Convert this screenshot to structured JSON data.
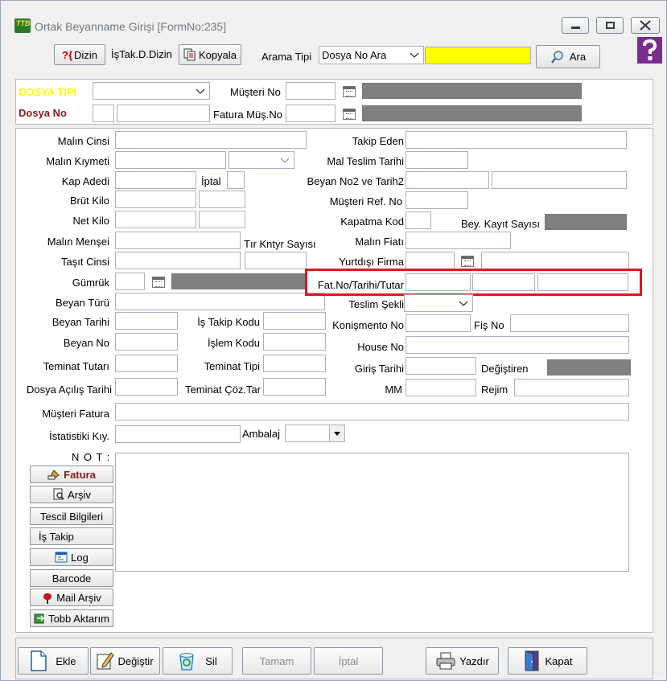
{
  "window": {
    "title": "Ortak Beyanname Girişi [FormNo:235]",
    "icon_text": "TTB",
    "min_icon": "minimize-icon",
    "max_icon": "maximize-icon",
    "close_icon": "close-icon"
  },
  "toolbar": {
    "dizin_label": "Dizin",
    "istak_label": "İşTak.D.Dizin",
    "kopyala_label": "Kopyala",
    "arama_tipi_label": "Arama Tipi",
    "arama_tipi_value": "Dosya No Ara",
    "ara_label": "Ara"
  },
  "top": {
    "dosya_tipi_label": "DOSYA TIPI",
    "musteri_no_label": "Müşteri No",
    "dosya_no_label": "Dosya No",
    "fatura_mus_no_label": "Fatura Müş.No"
  },
  "left_labels": {
    "malin_cinsi": "Malın Cinsi",
    "malin_kiymeti": "Malın Kıymeti",
    "kap_adedi": "Kap Adedi",
    "iptal": "İptal",
    "brut_kilo": "Brüt Kilo",
    "net_kilo": "Net Kilo",
    "malin_mensei": "Malın Menşei",
    "tir_kntyr": "Tır Kntyr Sayısı",
    "tasit_cinsi": "Taşıt Cinsi",
    "gumruk": "Gümrük",
    "beyan_turu": "Beyan Türü",
    "beyan_tarihi": "Beyan Tarihi",
    "is_takip_kodu": "İş Takip Kodu",
    "beyan_no": "Beyan No",
    "islem_kodu": "İşlem Kodu",
    "teminat_tutari": "Teminat Tutarı",
    "teminat_tipi": "Teminat Tipi",
    "dosya_acilis": "Dosya Açılış Tarihi",
    "teminat_coz": "Teminat Çöz.Tar",
    "musteri_fatura": "Müşteri Fatura",
    "istatistiki": "İstatistiki Kıy.",
    "ambalaj": "Ambalaj",
    "not": "N O T :"
  },
  "right_labels": {
    "takip_eden": "Takip Eden",
    "mal_teslim": "Mal Teslim Tarihi",
    "beyan_no2": "Beyan  No2 ve Tarih2",
    "musteri_ref": "Müşteri  Ref. No",
    "kapatma_kod": "Kapatma Kod",
    "bey_kayit": "Bey. Kayıt Sayısı",
    "malin_fiati": "Malın Fiatı",
    "yurtdisi_firma": "Yurtdışı Firma",
    "fat_no": "Fat.No/Tarihi/Tutar",
    "teslim_sekli": "Teslim Şekli",
    "konismento": "Konişmento No",
    "fis_no": "Fiş No",
    "house_no": "House No",
    "giris_tarihi": "Giriş Tarihi",
    "degistiren": "Değiştiren",
    "mm": "MM",
    "rejim": "Rejim"
  },
  "side_buttons": {
    "fatura": "Fatura",
    "arsiv": "Arşiv",
    "tescil": "Tescil Bilgileri",
    "is_takip": "İş Takip",
    "log": "Log",
    "barcode": "Barcode",
    "mail_arsiv": "Mail Arşiv",
    "tobb": "Tobb Aktarım"
  },
  "bottom_buttons": {
    "ekle": "Ekle",
    "degistir": "Değiştir",
    "sil": "Sil",
    "tamam": "Tamam",
    "iptal": "İptal",
    "yazdir": "Yazdır",
    "kapat": "Kapat"
  },
  "colors": {
    "dosya_tipi": "#ffff00",
    "dosya_no": "#8b1a1a",
    "highlight": "#e8141a"
  }
}
